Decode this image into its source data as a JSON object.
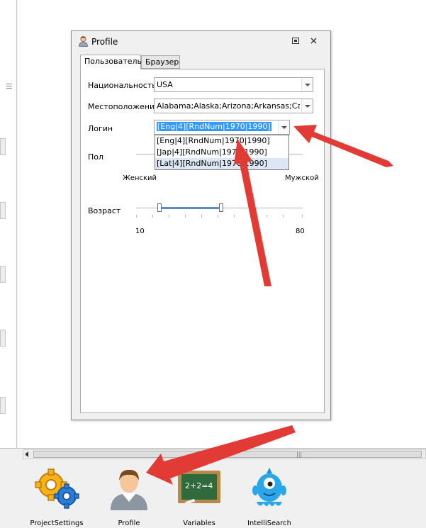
{
  "dialog": {
    "title": "Profile",
    "tabs": [
      {
        "label": "Пользователь",
        "active": true
      },
      {
        "label": "Браузер",
        "active": false
      }
    ]
  },
  "form": {
    "nationality": {
      "label": "Национальность",
      "value": "USA"
    },
    "location": {
      "label": "Местоположение",
      "value": "Alabama;Alaska;Arizona;Arkansas;Calif..."
    },
    "login": {
      "label": "Логин",
      "value": "[Eng|4][RndNum|1970|1990]",
      "options": [
        "[Eng|4][RndNum|1970|1990]",
        "[Jap|4][RndNum|1970|1990]",
        "[Lat|4][RndNum|1970|1990]"
      ]
    },
    "gender": {
      "label": "Пол",
      "left_label": "Женский",
      "right_label": "Мужской"
    },
    "age": {
      "label": "Возраст",
      "min_label": "10",
      "max_label": "80"
    }
  },
  "toolbar": {
    "items": [
      {
        "label": "ProjectSettings",
        "icon": "gears-icon"
      },
      {
        "label": "Profile",
        "icon": "user-profile-icon"
      },
      {
        "label": "Variables",
        "icon": "chalkboard-icon"
      },
      {
        "label": "IntelliSearch",
        "icon": "blue-monster-icon"
      }
    ]
  },
  "colors": {
    "selection": "#3399ff",
    "arrow": "#e23a34",
    "slider_fill": "#5b8bd1"
  }
}
